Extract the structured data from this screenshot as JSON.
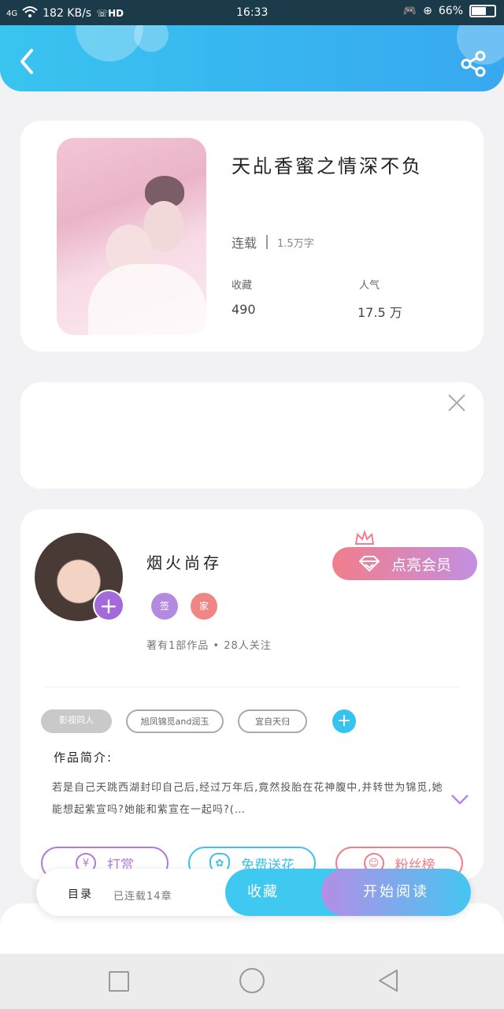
{
  "status_bar": {
    "network": "4G",
    "speed": "182 KB/s",
    "hd": "HD",
    "time": "16:33",
    "battery": "66%",
    "battery_level": 0.66
  },
  "header": {
    "back_icon": "chevron-left-icon",
    "share_icon": "share-icon"
  },
  "book": {
    "title": "天乩香蜜之情深不负",
    "status": "连载",
    "word_count": "1.5万字",
    "favorites_label": "收藏",
    "favorites_value": "490",
    "popularity_label": "人气",
    "popularity_value": "17.5 万"
  },
  "ad": {
    "close_icon": "close-icon"
  },
  "author": {
    "name": "烟火尚存",
    "badge_sign": "签",
    "badge_family": "家",
    "vip_button": "点亮会员",
    "meta": "著有1部作品 • 28人关注",
    "tags": [
      "影视同人",
      "旭凤锦觅and润玉",
      "宜自天归"
    ],
    "intro_label": "作品简介:",
    "intro_text": "若是自己天跳西湖封印自己后,经过万年后,竟然投胎在花神腹中,并转世为锦觅,她能想起紫宣吗?她能和紫宣在一起吗?(…"
  },
  "actions": {
    "reward": "打赏",
    "flower": "免费送花",
    "fans": "粉丝榜",
    "reward_icon": "yen-icon",
    "flower_icon": "flower-icon",
    "fans_icon": "person-icon"
  },
  "bottom_bar": {
    "toc": "目录",
    "serial_status": "已连载14章",
    "favorite": "收藏",
    "start_reading": "开始阅读"
  },
  "colors": {
    "header_start": "#39c4ef",
    "header_end": "#38a8f0",
    "vip_start": "#f27e8c",
    "vip_end": "#c38fe0",
    "reward": "#b07ad8",
    "flower": "#3cc2ee",
    "fans": "#ef7e85"
  }
}
